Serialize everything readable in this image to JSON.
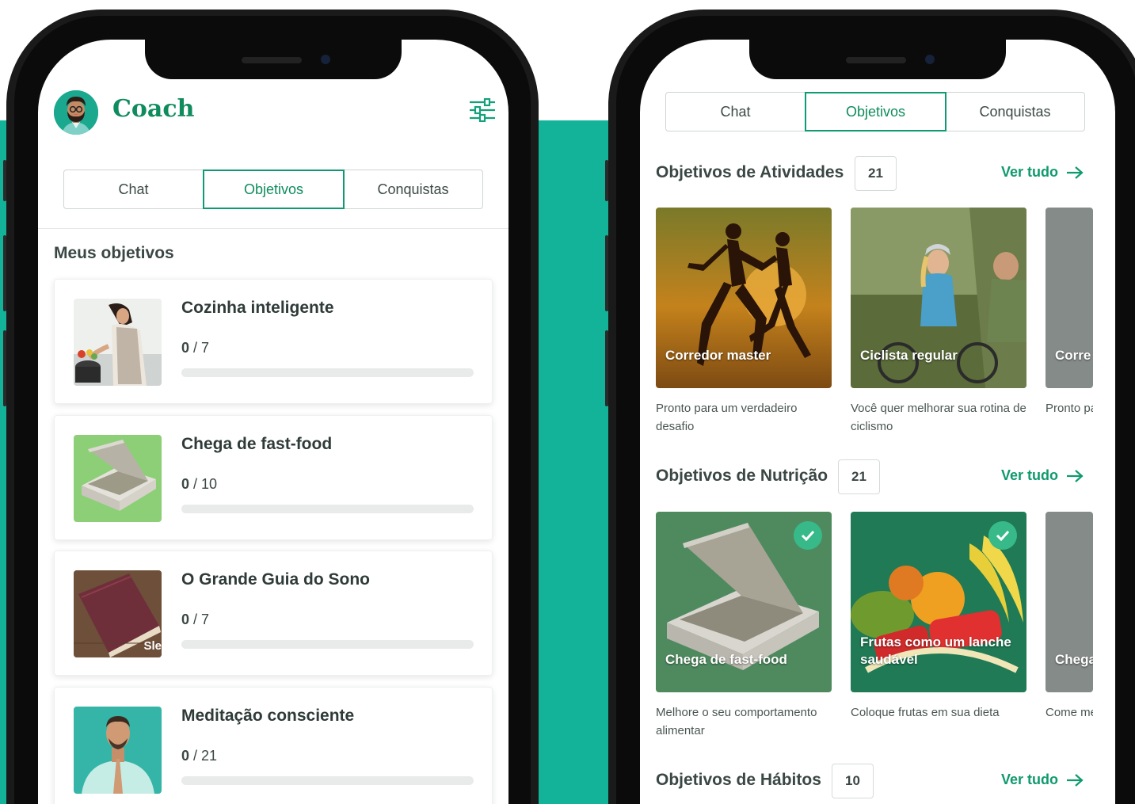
{
  "left": {
    "app_title": "Coach",
    "tabs": [
      {
        "label": "Chat",
        "active": false
      },
      {
        "label": "Objetivos",
        "active": true
      },
      {
        "label": "Conquistas",
        "active": false
      }
    ],
    "section_title": "Meus objetivos",
    "goals": [
      {
        "name": "Cozinha inteligente",
        "done": "0",
        "sep_total": " / 7",
        "progress": 0
      },
      {
        "name": "Chega de fast-food",
        "done": "0",
        "sep_total": " / 10",
        "progress": 0
      },
      {
        "name": "O Grande Guia do Sono",
        "done": "0",
        "sep_total": " / 7",
        "progress": 0
      },
      {
        "name": "Meditação consciente",
        "done": "0",
        "sep_total": " / 21",
        "progress": 0
      }
    ],
    "sleep_thumb_text": "Sle"
  },
  "right": {
    "tabs": [
      {
        "label": "Chat",
        "active": false
      },
      {
        "label": "Objetivos",
        "active": true
      },
      {
        "label": "Conquistas",
        "active": false
      }
    ],
    "categories": [
      {
        "title": "Objetivos de Atividades",
        "count": "21",
        "see_all": "Ver tudo",
        "tiles": [
          {
            "label": "Corredor master",
            "desc": "Pronto para um verdadeiro desafio"
          },
          {
            "label": "Ciclista regular",
            "desc": "Você quer melhorar sua rotina de ciclismo"
          },
          {
            "label": "Corre",
            "desc": "Pronto pa regime d"
          }
        ]
      },
      {
        "title": "Objetivos de Nutrição",
        "count": "21",
        "see_all": "Ver tudo",
        "tiles": [
          {
            "label": "Chega de fast-food",
            "desc": "Melhore o seu comportamento alimentar",
            "completed": true
          },
          {
            "label": "Frutas como um lanche saudável",
            "desc": "Coloque frutas em sua dieta",
            "completed": true
          },
          {
            "label": "Chega",
            "desc": "Come me frequent"
          }
        ]
      },
      {
        "title": "Objetivos de Hábitos",
        "count": "10",
        "see_all": "Ver tudo"
      }
    ]
  },
  "colors": {
    "brand_green": "#0f8c5d",
    "teal_background": "#13b39a",
    "check_green": "#38b98a"
  },
  "icons": [
    "filter-sliders-icon",
    "arrow-right-icon",
    "check-icon",
    "coach-avatar"
  ]
}
